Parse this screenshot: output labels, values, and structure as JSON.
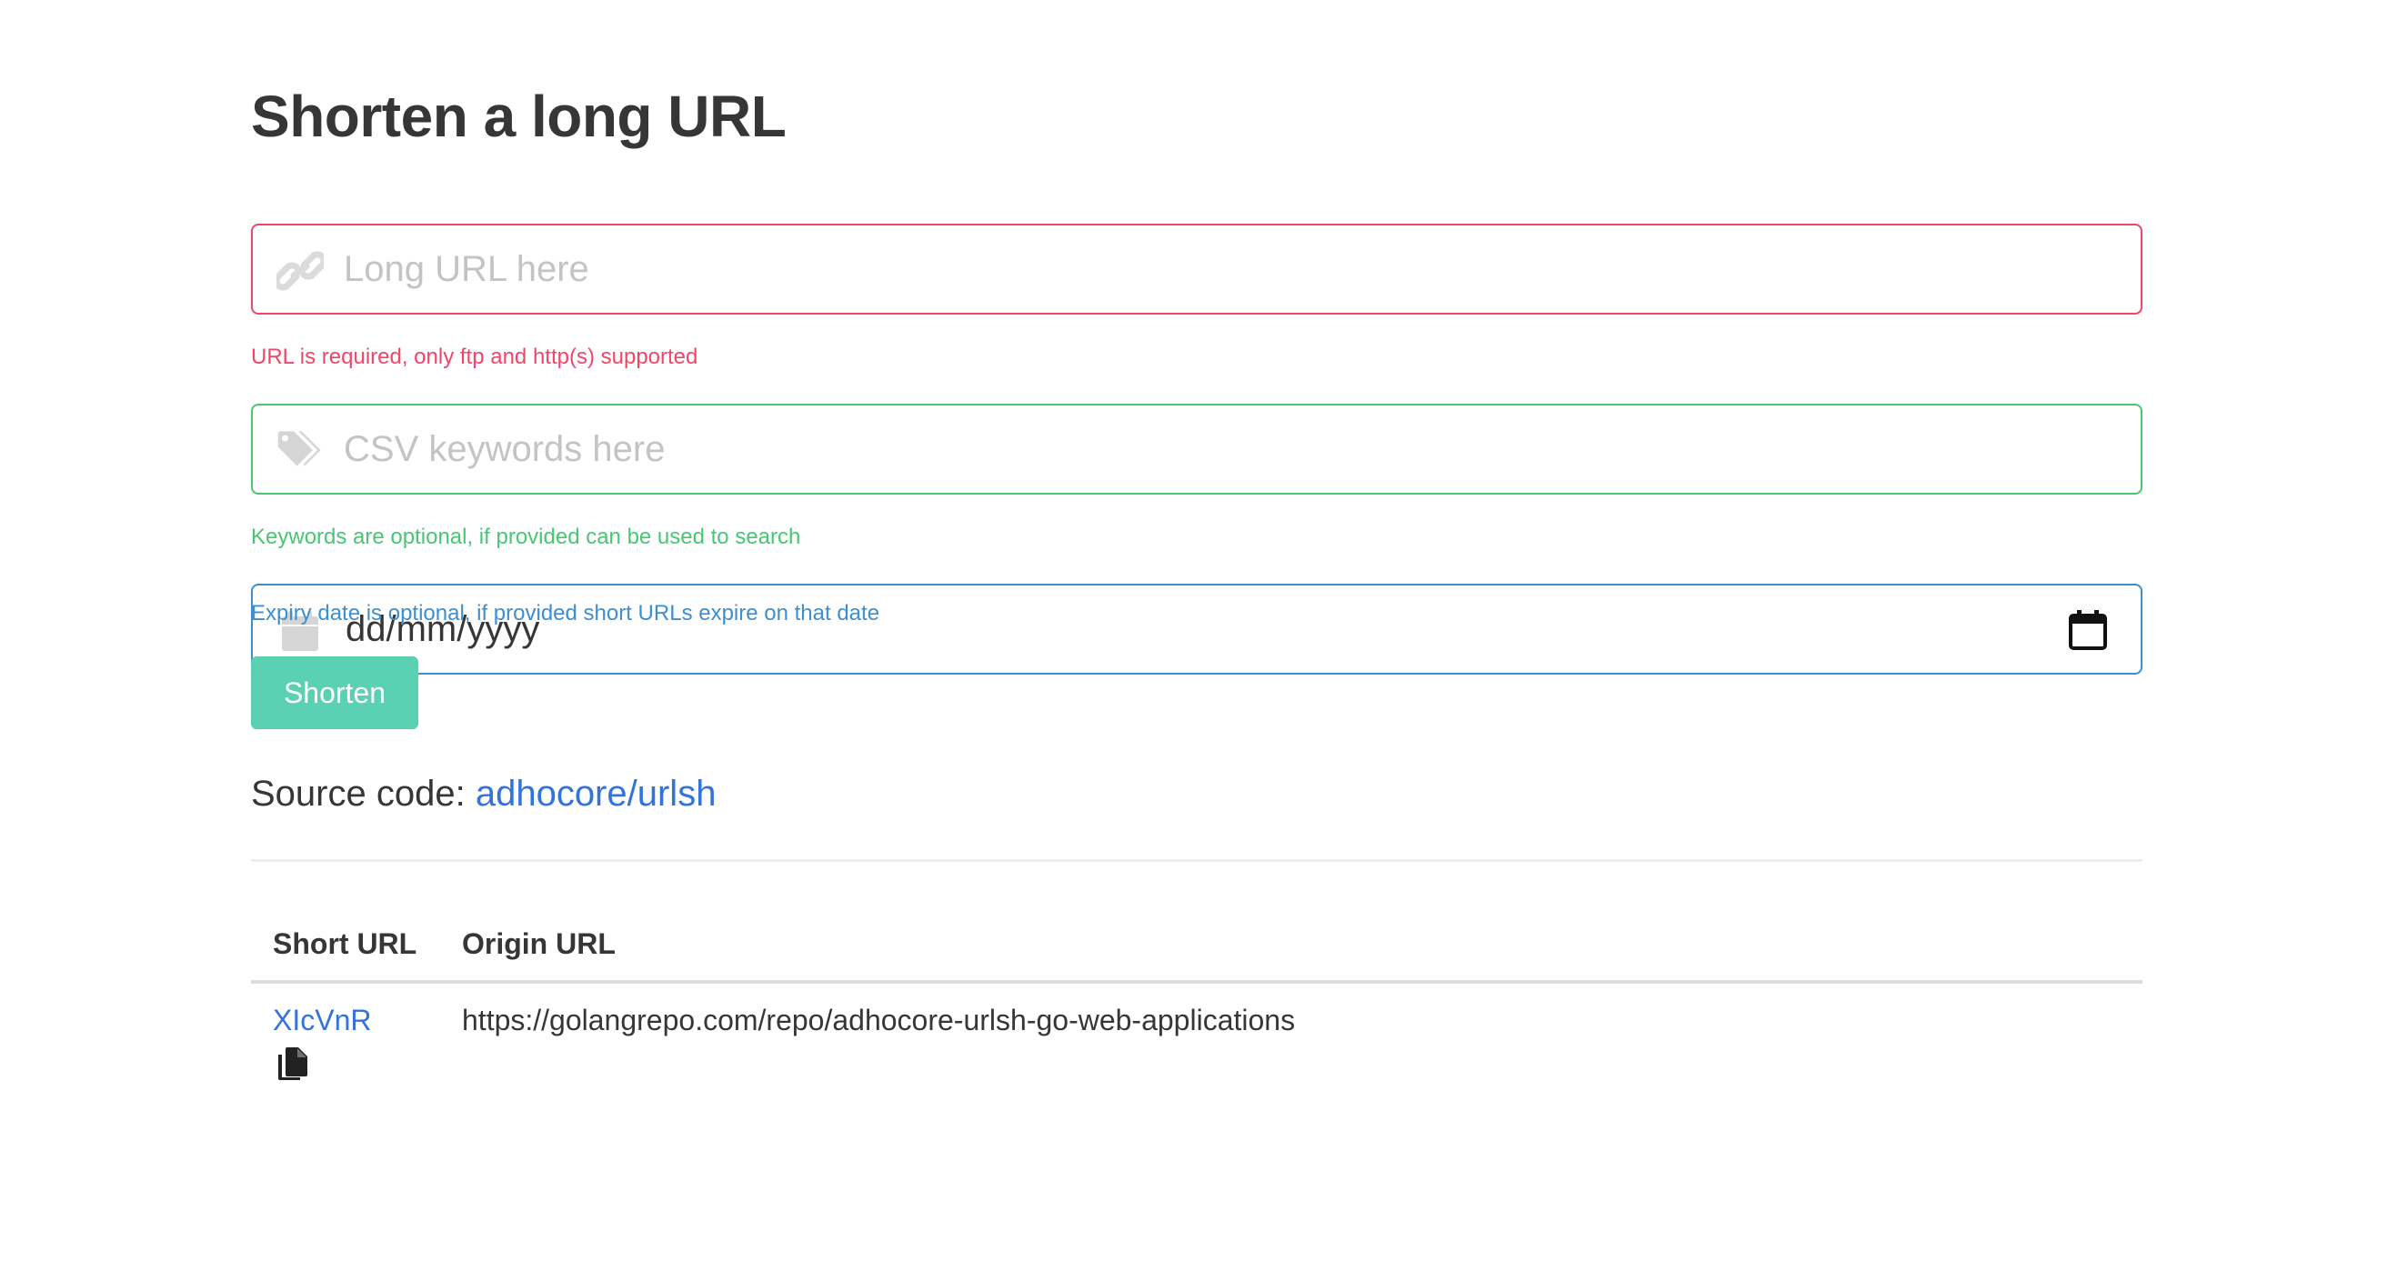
{
  "header": {
    "title": "Shorten a long URL"
  },
  "form": {
    "url_field": {
      "placeholder": "Long URL here",
      "value": "",
      "help": "URL is required, only ftp and http(s) supported",
      "icon": "link-icon",
      "status_color": "#f14668"
    },
    "keywords_field": {
      "placeholder": "CSV keywords here",
      "value": "",
      "help": "Keywords are optional, if provided can be used to search",
      "icon": "tags-icon",
      "status_color": "#48c774"
    },
    "expiry_field": {
      "value": "dd/mm/yyyy",
      "help": "Expiry date is optional, if provided short URLs expire on that date",
      "icon": "calendar-icon",
      "picker_icon": "calendar-picker-icon",
      "status_color": "#3e8ed0"
    },
    "submit_label": "Shorten",
    "submit_color": "#5bd1b4"
  },
  "source": {
    "label": "Source code:",
    "link_text": "adhocore/urlsh"
  },
  "table": {
    "columns": [
      "Short URL",
      "Origin URL"
    ],
    "rows": [
      {
        "short": "XIcVnR",
        "origin": "https://golangrepo.com/repo/adhocore-urlsh-go-web-applications",
        "copy_icon": "copy-icon"
      }
    ]
  },
  "colors": {
    "link": "#3273dc",
    "text": "#363636"
  }
}
